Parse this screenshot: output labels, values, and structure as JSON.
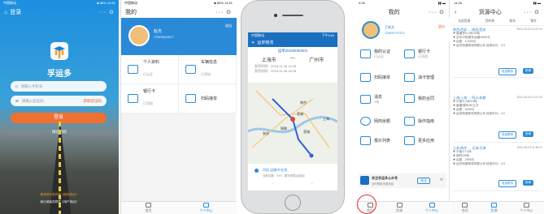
{
  "s1": {
    "status_left": "中国移动",
    "status_right": "■ 88% 14:51",
    "title": "登录",
    "nav_right": "···  ⊙",
    "app_name": "孚运多",
    "phone_placeholder": "请输入手机号",
    "code_placeholder": "请输入验证码",
    "get_code": "获取验证码",
    "login": "登录",
    "wechat": "微信授权",
    "agree_prefix": "登录即代表同意",
    "agreement": "《服务协议》",
    "footer": "我已阅读并同意《用户协议》"
  },
  "s2": {
    "status_left": "中国移动",
    "status_right": "■ 88% 14:51",
    "title": "我的",
    "nav_right": "···  ⊙",
    "user_name": "赵杰",
    "user_phone": "17521512017",
    "logout": "退出",
    "menu": [
      {
        "label": "个人资料",
        "sub": "已认证"
      },
      {
        "label": "车辆信息",
        "sub": "已添加"
      },
      {
        "label": "银行卡",
        "sub": "已添加"
      },
      {
        "label": "扫码接单",
        "sub": ""
      }
    ],
    "tabs": [
      {
        "label": "首页"
      },
      {
        "label": "个人中心"
      }
    ]
  },
  "s3": {
    "status_left": "中国移动",
    "status_right": "下午3:54",
    "header": "运单物流",
    "order_no": "运单20180000001",
    "from": "上海市",
    "to": "广州市",
    "dash": "—",
    "row1": "发货时间：2018-11-26 14:18",
    "row2": "到货时间：2018-11-26 16:18",
    "city_labels": [
      "芜湖",
      "南京",
      "宣城",
      "上海",
      "安庆",
      "铜陵"
    ],
    "track_title": "司机  运输中/在途",
    "track_sub": "当前位置：XXX（暂无停靠点信息）"
  },
  "s4": {
    "status_left": "4:28",
    "status_right": "14:26",
    "title_left": "我的",
    "title_right": "货源中心",
    "nav_right": "···  ⊙",
    "user_name": "王新文",
    "user_phone": "13825737372",
    "logout": "退出",
    "menu": [
      {
        "label": "我的认证",
        "sub": "已认证"
      },
      {
        "label": "银行卡",
        "sub": "已添加"
      },
      {
        "label": "扫码接单",
        "sub": ""
      },
      {
        "label": "油卡管理",
        "sub": ""
      },
      {
        "label": "消息",
        "sub": "3条"
      },
      {
        "label": "我的合同",
        "sub": ""
      },
      {
        "label": "网商余额",
        "sub": ""
      },
      {
        "label": "操作指南",
        "sub": ""
      },
      {
        "label": "报价列表",
        "sub": ""
      },
      {
        "label": "更多应用",
        "sub": ""
      }
    ],
    "filters": [
      "全部货源",
      "目的地",
      "装车",
      "零车"
    ],
    "cards": [
      {
        "route": "陕西/西安 → 陕西/西安",
        "date": "2021-05-03 14:23:10",
        "l1": "✚ 普通货/4.2米/10吨",
        "l2": "✚ 空车/2吨/整车运输/4500元",
        "l3": "✚ 运费：12000元",
        "l4": "✚ 运货快递物流有限公司 信用评分：4.3",
        "b1": "电话联系",
        "b2": "抢单"
      },
      {
        "route": "上海/上海 → 四川/成都",
        "date": "2021-05-03 12:47:30",
        "l1": "✚ 平板/4.2米/10吨",
        "l2": "✚ 普通/整车/80立方",
        "l3": "✚ 运费：6000元",
        "l4": "✚ 运货快递物流有限公司 信用评分：4.2",
        "b1": "电话联系",
        "b2": "抢单"
      },
      {
        "route": "江苏/南京 → 天津/天津",
        "date": "2021-05-03 11:36:21",
        "l1": "✚ 平板/17.5米",
        "l2": "✚ 钢材/20吨",
        "l3": "✚ 运费：2000元",
        "l4": "✚ 运货快递物流有限公司 信用评分：4.3",
        "b1": "电话联系",
        "b2": "抢单"
      }
    ],
    "notice_title": "关注孚运多公众号",
    "notice_sub": "及时获取货源消息",
    "notice_btn": "关注",
    "tabs_left": [
      {
        "label": "首页"
      },
      {
        "label": "货源"
      },
      {
        "label": "个人中心"
      }
    ],
    "tabs_right": [
      {
        "label": "首页"
      },
      {
        "label": "货源"
      },
      {
        "label": "个人中心"
      }
    ]
  }
}
